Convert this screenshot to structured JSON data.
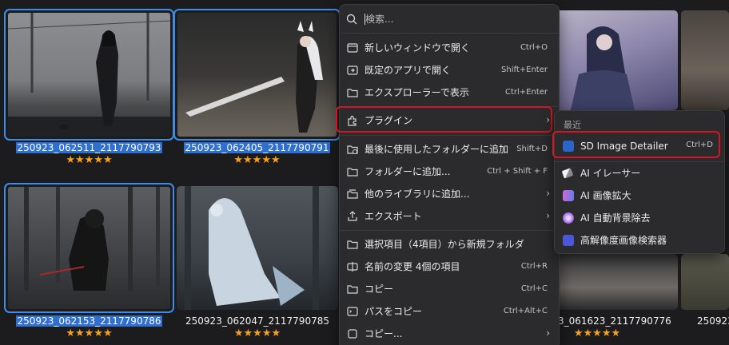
{
  "gallery": {
    "items": [
      {
        "filename": "250923_062511_2117790793",
        "rating": "★★★★★",
        "selected": true
      },
      {
        "filename": "250923_062405_2117790791",
        "rating": "★★★★★",
        "selected": true
      },
      {
        "filename": "250923_062153_2117790786",
        "rating": "★★★★★",
        "selected": true
      },
      {
        "filename": "250923_062047_2117790785",
        "rating": "★★★★★",
        "selected": false
      },
      {
        "filename": "3_061623_2117790776",
        "rating": "★★★★★",
        "selected": false
      },
      {
        "filename": "250923",
        "rating": "",
        "selected": false
      }
    ]
  },
  "menu": {
    "search_placeholder": "検索...",
    "items": [
      {
        "label": "新しいウィンドウで開く",
        "shortcut": "Ctrl+O",
        "icon": "new-window-icon"
      },
      {
        "label": "既定のアプリで開く",
        "shortcut": "Shift+Enter",
        "icon": "open-app-icon"
      },
      {
        "label": "エクスプローラーで表示",
        "shortcut": "Ctrl+Enter",
        "icon": "explorer-icon"
      },
      {
        "label": "プラグイン",
        "shortcut": "",
        "icon": "plugin-icon",
        "submenu": true
      },
      {
        "label": "最後に使用したフォルダーに追加",
        "shortcut": "Shift+D",
        "icon": "recent-folder-icon"
      },
      {
        "label": "フォルダーに追加...",
        "shortcut": "Ctrl + Shift + F",
        "icon": "add-folder-icon"
      },
      {
        "label": "他のライブラリに追加...",
        "shortcut": "",
        "icon": "library-icon",
        "submenu": true
      },
      {
        "label": "エクスポート",
        "shortcut": "",
        "icon": "export-icon",
        "submenu": true
      },
      {
        "label": "選択項目（4項目）から新規フォルダ",
        "shortcut": "",
        "icon": "new-folder-icon"
      },
      {
        "label": "名前の変更 4個の項目",
        "shortcut": "Ctrl+R",
        "icon": "rename-icon"
      },
      {
        "label": "コピー",
        "shortcut": "Ctrl+C",
        "icon": "copy-icon"
      },
      {
        "label": "パスをコピー",
        "shortcut": "Ctrl+Alt+C",
        "icon": "copy-path-icon"
      },
      {
        "label": "コピー...",
        "shortcut": "",
        "icon": "copy-more-icon",
        "submenu": true
      }
    ]
  },
  "submenu": {
    "header": "最近",
    "items": [
      {
        "label": "SD Image Detailer",
        "shortcut": "Ctrl+D",
        "icon": "sd-detailer-icon"
      },
      {
        "label": "AI イレーサー",
        "shortcut": "",
        "icon": "eraser-icon"
      },
      {
        "label": "AI 画像拡大",
        "shortcut": "",
        "icon": "upscale-icon"
      },
      {
        "label": "AI 自動背景除去",
        "shortcut": "",
        "icon": "bg-remove-icon"
      },
      {
        "label": "高解像度画像検索器",
        "shortcut": "",
        "icon": "hires-search-icon"
      }
    ]
  },
  "colors": {
    "selection": "#3f8ce8",
    "highlight": "#d3161f",
    "star": "#f6a21a",
    "menu_bg": "#2b2b2d"
  }
}
